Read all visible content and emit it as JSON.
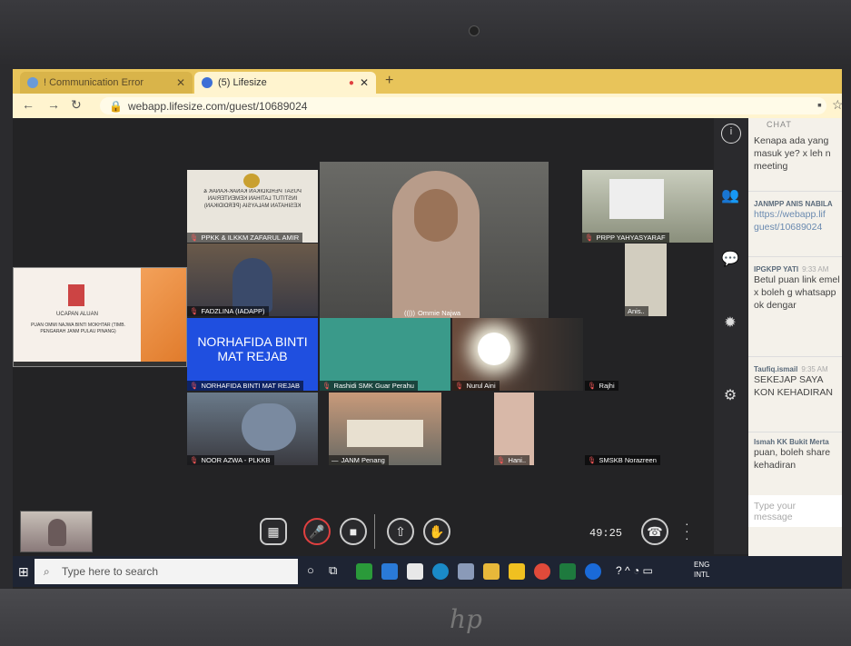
{
  "browser": {
    "tabs": [
      {
        "label": "! Communication Error"
      },
      {
        "label": "(5) Lifesize"
      }
    ],
    "new_tab": "+",
    "url": "webapp.lifesize.com/guest/10689024"
  },
  "participants": [
    {
      "name": "PPKK & ILKKM ZAFARUL AMIR"
    },
    {
      "name": "FADZLINA (IADAPP)"
    },
    {
      "name": "Ommie Najwa"
    },
    {
      "name": "PRPP YAHYASYARAF"
    },
    {
      "name": "Anis.."
    },
    {
      "name": "NORHAFIDA BINTI MAT REJAB"
    },
    {
      "name": "Rashidi SMK Guar Perahu"
    },
    {
      "name": "Nurul  Aini"
    },
    {
      "name": "Rajhi"
    },
    {
      "name": "NOOR AZWA - PLKKB"
    },
    {
      "name": "JANM Penang"
    },
    {
      "name": "Hani.."
    },
    {
      "name": "SMSKB Norazreen"
    }
  ],
  "slide_text": {
    "org": "PUSAT PERDIDIKAN KANAK-KANAK & INSTITUT LATIHAN KEMENTERIAN KESIHATAN MALAYSIA (PERDIDIKAN)",
    "ucapan": "UCAPAN ALUAN",
    "speaker": "PUAN OMMI NAJWA BINTI MOKHTAR (TIMB. PENGARAH JANM PULAU PINANG)"
  },
  "name_card": "NORHAFIDA BINTI MAT REJAB",
  "chat": {
    "header": "CHAT",
    "messages": [
      {
        "user": "",
        "time": "",
        "text": "Kenapa ada yang masuk ye? x leh n meeting"
      },
      {
        "user": "JANMPP ANIS NABILA",
        "time": "",
        "text": "https://webapp.lif guest/10689024"
      },
      {
        "user": "IPGKPP YATI",
        "time": "9:33 AM",
        "text": "Betul puan link emel x boleh g whatsapp ok dengar"
      },
      {
        "user": "Taufiq.ismail",
        "time": "9:35 AM",
        "text": "SEKEJAP SAYA KON KEHADIRAN"
      },
      {
        "user": "Ismah KK Bukit Merta",
        "time": "",
        "text": "puan, boleh share kehadiran"
      }
    ],
    "input_placeholder": "Type your message"
  },
  "call": {
    "timer": "49:25"
  },
  "taskbar": {
    "search_placeholder": "Type here to search",
    "lang": "ENG",
    "lang2": "INTL"
  },
  "brand": "hp"
}
